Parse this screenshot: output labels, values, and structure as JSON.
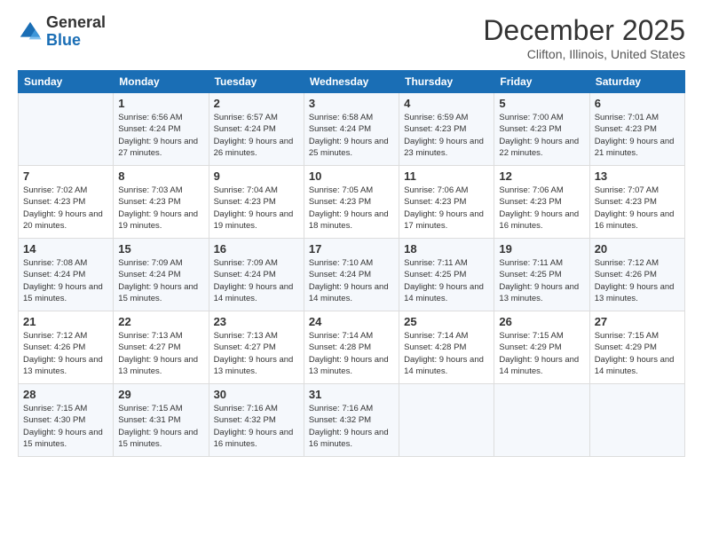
{
  "header": {
    "logo_line1": "General",
    "logo_line2": "Blue",
    "month": "December 2025",
    "location": "Clifton, Illinois, United States"
  },
  "weekdays": [
    "Sunday",
    "Monday",
    "Tuesday",
    "Wednesday",
    "Thursday",
    "Friday",
    "Saturday"
  ],
  "weeks": [
    [
      {
        "day": "",
        "sunrise": "",
        "sunset": "",
        "daylight": ""
      },
      {
        "day": "1",
        "sunrise": "Sunrise: 6:56 AM",
        "sunset": "Sunset: 4:24 PM",
        "daylight": "Daylight: 9 hours and 27 minutes."
      },
      {
        "day": "2",
        "sunrise": "Sunrise: 6:57 AM",
        "sunset": "Sunset: 4:24 PM",
        "daylight": "Daylight: 9 hours and 26 minutes."
      },
      {
        "day": "3",
        "sunrise": "Sunrise: 6:58 AM",
        "sunset": "Sunset: 4:24 PM",
        "daylight": "Daylight: 9 hours and 25 minutes."
      },
      {
        "day": "4",
        "sunrise": "Sunrise: 6:59 AM",
        "sunset": "Sunset: 4:23 PM",
        "daylight": "Daylight: 9 hours and 23 minutes."
      },
      {
        "day": "5",
        "sunrise": "Sunrise: 7:00 AM",
        "sunset": "Sunset: 4:23 PM",
        "daylight": "Daylight: 9 hours and 22 minutes."
      },
      {
        "day": "6",
        "sunrise": "Sunrise: 7:01 AM",
        "sunset": "Sunset: 4:23 PM",
        "daylight": "Daylight: 9 hours and 21 minutes."
      }
    ],
    [
      {
        "day": "7",
        "sunrise": "Sunrise: 7:02 AM",
        "sunset": "Sunset: 4:23 PM",
        "daylight": "Daylight: 9 hours and 20 minutes."
      },
      {
        "day": "8",
        "sunrise": "Sunrise: 7:03 AM",
        "sunset": "Sunset: 4:23 PM",
        "daylight": "Daylight: 9 hours and 19 minutes."
      },
      {
        "day": "9",
        "sunrise": "Sunrise: 7:04 AM",
        "sunset": "Sunset: 4:23 PM",
        "daylight": "Daylight: 9 hours and 19 minutes."
      },
      {
        "day": "10",
        "sunrise": "Sunrise: 7:05 AM",
        "sunset": "Sunset: 4:23 PM",
        "daylight": "Daylight: 9 hours and 18 minutes."
      },
      {
        "day": "11",
        "sunrise": "Sunrise: 7:06 AM",
        "sunset": "Sunset: 4:23 PM",
        "daylight": "Daylight: 9 hours and 17 minutes."
      },
      {
        "day": "12",
        "sunrise": "Sunrise: 7:06 AM",
        "sunset": "Sunset: 4:23 PM",
        "daylight": "Daylight: 9 hours and 16 minutes."
      },
      {
        "day": "13",
        "sunrise": "Sunrise: 7:07 AM",
        "sunset": "Sunset: 4:23 PM",
        "daylight": "Daylight: 9 hours and 16 minutes."
      }
    ],
    [
      {
        "day": "14",
        "sunrise": "Sunrise: 7:08 AM",
        "sunset": "Sunset: 4:24 PM",
        "daylight": "Daylight: 9 hours and 15 minutes."
      },
      {
        "day": "15",
        "sunrise": "Sunrise: 7:09 AM",
        "sunset": "Sunset: 4:24 PM",
        "daylight": "Daylight: 9 hours and 15 minutes."
      },
      {
        "day": "16",
        "sunrise": "Sunrise: 7:09 AM",
        "sunset": "Sunset: 4:24 PM",
        "daylight": "Daylight: 9 hours and 14 minutes."
      },
      {
        "day": "17",
        "sunrise": "Sunrise: 7:10 AM",
        "sunset": "Sunset: 4:24 PM",
        "daylight": "Daylight: 9 hours and 14 minutes."
      },
      {
        "day": "18",
        "sunrise": "Sunrise: 7:11 AM",
        "sunset": "Sunset: 4:25 PM",
        "daylight": "Daylight: 9 hours and 14 minutes."
      },
      {
        "day": "19",
        "sunrise": "Sunrise: 7:11 AM",
        "sunset": "Sunset: 4:25 PM",
        "daylight": "Daylight: 9 hours and 13 minutes."
      },
      {
        "day": "20",
        "sunrise": "Sunrise: 7:12 AM",
        "sunset": "Sunset: 4:26 PM",
        "daylight": "Daylight: 9 hours and 13 minutes."
      }
    ],
    [
      {
        "day": "21",
        "sunrise": "Sunrise: 7:12 AM",
        "sunset": "Sunset: 4:26 PM",
        "daylight": "Daylight: 9 hours and 13 minutes."
      },
      {
        "day": "22",
        "sunrise": "Sunrise: 7:13 AM",
        "sunset": "Sunset: 4:27 PM",
        "daylight": "Daylight: 9 hours and 13 minutes."
      },
      {
        "day": "23",
        "sunrise": "Sunrise: 7:13 AM",
        "sunset": "Sunset: 4:27 PM",
        "daylight": "Daylight: 9 hours and 13 minutes."
      },
      {
        "day": "24",
        "sunrise": "Sunrise: 7:14 AM",
        "sunset": "Sunset: 4:28 PM",
        "daylight": "Daylight: 9 hours and 13 minutes."
      },
      {
        "day": "25",
        "sunrise": "Sunrise: 7:14 AM",
        "sunset": "Sunset: 4:28 PM",
        "daylight": "Daylight: 9 hours and 14 minutes."
      },
      {
        "day": "26",
        "sunrise": "Sunrise: 7:15 AM",
        "sunset": "Sunset: 4:29 PM",
        "daylight": "Daylight: 9 hours and 14 minutes."
      },
      {
        "day": "27",
        "sunrise": "Sunrise: 7:15 AM",
        "sunset": "Sunset: 4:29 PM",
        "daylight": "Daylight: 9 hours and 14 minutes."
      }
    ],
    [
      {
        "day": "28",
        "sunrise": "Sunrise: 7:15 AM",
        "sunset": "Sunset: 4:30 PM",
        "daylight": "Daylight: 9 hours and 15 minutes."
      },
      {
        "day": "29",
        "sunrise": "Sunrise: 7:15 AM",
        "sunset": "Sunset: 4:31 PM",
        "daylight": "Daylight: 9 hours and 15 minutes."
      },
      {
        "day": "30",
        "sunrise": "Sunrise: 7:16 AM",
        "sunset": "Sunset: 4:32 PM",
        "daylight": "Daylight: 9 hours and 16 minutes."
      },
      {
        "day": "31",
        "sunrise": "Sunrise: 7:16 AM",
        "sunset": "Sunset: 4:32 PM",
        "daylight": "Daylight: 9 hours and 16 minutes."
      },
      {
        "day": "",
        "sunrise": "",
        "sunset": "",
        "daylight": ""
      },
      {
        "day": "",
        "sunrise": "",
        "sunset": "",
        "daylight": ""
      },
      {
        "day": "",
        "sunrise": "",
        "sunset": "",
        "daylight": ""
      }
    ]
  ]
}
